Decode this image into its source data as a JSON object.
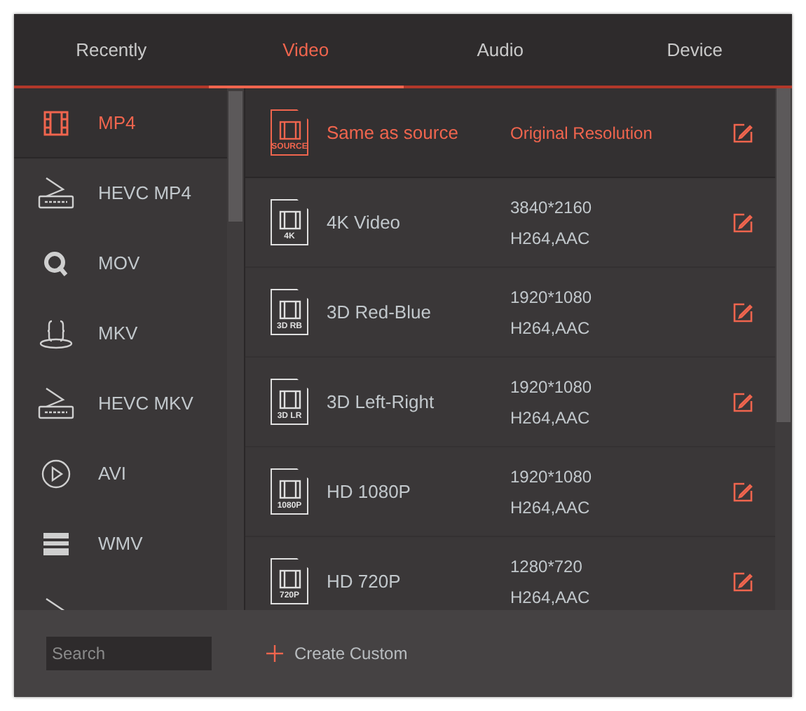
{
  "tabs": [
    {
      "label": "Recently",
      "selected": false
    },
    {
      "label": "Video",
      "selected": true
    },
    {
      "label": "Audio",
      "selected": false
    },
    {
      "label": "Device",
      "selected": false
    }
  ],
  "formats": [
    {
      "label": "MP4",
      "kind": "film",
      "selected": true
    },
    {
      "label": "HEVC MP4",
      "kind": "hevc",
      "selected": false
    },
    {
      "label": "MOV",
      "kind": "quick",
      "selected": false
    },
    {
      "label": "MKV",
      "kind": "braces",
      "selected": false
    },
    {
      "label": "HEVC MKV",
      "kind": "hevc",
      "selected": false
    },
    {
      "label": "AVI",
      "kind": "play",
      "selected": false
    },
    {
      "label": "WMV",
      "kind": "clapper",
      "selected": false
    },
    {
      "kind": "hevc",
      "selected": false
    }
  ],
  "presets": [
    {
      "name": "Same as source",
      "badge": "SOURCE",
      "resolution": "Original Resolution",
      "selected": true
    },
    {
      "name": "4K Video",
      "badge": "4K",
      "resolution": "3840*2160",
      "codec": "H264,AAC",
      "selected": false
    },
    {
      "name": "3D Red-Blue",
      "badge": "3D RB",
      "resolution": "1920*1080",
      "codec": "H264,AAC",
      "selected": false
    },
    {
      "name": "3D Left-Right",
      "badge": "3D LR",
      "resolution": "1920*1080",
      "codec": "H264,AAC",
      "selected": false
    },
    {
      "name": "HD 1080P",
      "badge": "1080P",
      "resolution": "1920*1080",
      "codec": "H264,AAC",
      "selected": false
    },
    {
      "name": "HD 720P",
      "badge": "720P",
      "resolution": "1280*720",
      "codec": "H264,AAC",
      "selected": false
    }
  ],
  "search": {
    "placeholder": "Search"
  },
  "create_button": {
    "label": "Create Custom"
  }
}
